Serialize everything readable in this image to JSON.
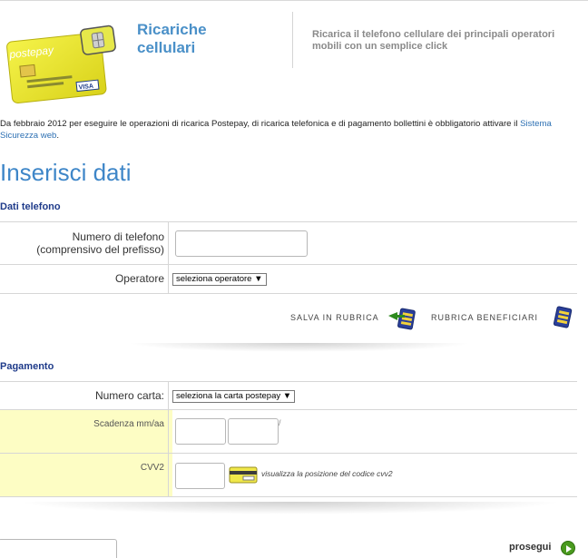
{
  "header": {
    "card_brand": "postepay",
    "card_network": "VISA",
    "title": "Ricariche cellulari",
    "description": "Ricarica il telefono cellulare dei principali operatori mobili con un semplice click"
  },
  "notice": {
    "text": "Da febbraio 2012 per eseguire le operazioni di ricarica Postepay, di ricarica telefonica e di pagamento bollettini è obbligatorio attivare il",
    "link": "Sistema Sicurezza web",
    "suffix": "."
  },
  "page_title": "Inserisci dati",
  "dati_telefono": {
    "section_title": "Dati telefono",
    "phone_label_line1": "Numero di telefono",
    "phone_label_line2": "(comprensivo del prefisso)",
    "phone_value": "",
    "operator_label": "Operatore",
    "operator_selected": "seleziona operatore ▼",
    "salva_label": "SALVA IN RUBRICA",
    "rubrica_label": "RUBRICA BENEFICIARI"
  },
  "pagamento": {
    "section_title": "Pagamento",
    "card_label": "Numero carta:",
    "card_selected": "seleziona la carta postepay ▼",
    "scadenza_label": "Scadenza mm/aa",
    "scadenza_sep": "/",
    "cvv_label": "CVV2",
    "cvv_hint": "visualizza la posizione del codice cvv2"
  },
  "footer": {
    "prosegui_label": "prosegui"
  },
  "colors": {
    "accent_blue": "#3e86c8",
    "section_blue": "#1f3b8a",
    "highlight_yellow": "#fdfdc4",
    "go_green": "#4a9a1e"
  }
}
